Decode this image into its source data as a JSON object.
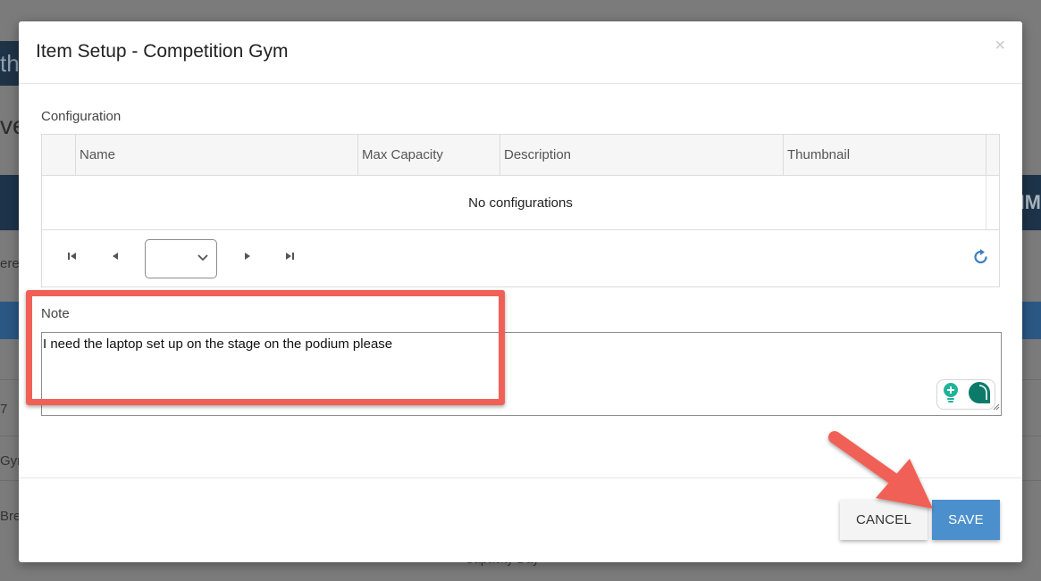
{
  "background": {
    "bar_text": "th",
    "heading_fragment": "ve",
    "nav_fragment": "MM",
    "rows": [
      "ere",
      "7",
      "Gyr",
      "Bre"
    ],
    "bottom_text": "Capacity Day"
  },
  "modal": {
    "title": "Item Setup - Competition Gym",
    "close_label": "×"
  },
  "configuration": {
    "label": "Configuration",
    "columns": [
      "",
      "Name",
      "Max Capacity",
      "Description",
      "Thumbnail"
    ],
    "empty_message": "No configurations",
    "pager": {
      "first": "⏮",
      "prev": "◀",
      "next": "▶",
      "last": "⏭",
      "page_value": ""
    }
  },
  "note": {
    "label": "Note",
    "value": "I need the laptop set up on the stage on the podium please"
  },
  "footer": {
    "cancel_label": "CANCEL",
    "save_label": "SAVE"
  },
  "colors": {
    "highlight": "#f06057",
    "save": "#4b8fcc",
    "nav": "#1d3349"
  }
}
